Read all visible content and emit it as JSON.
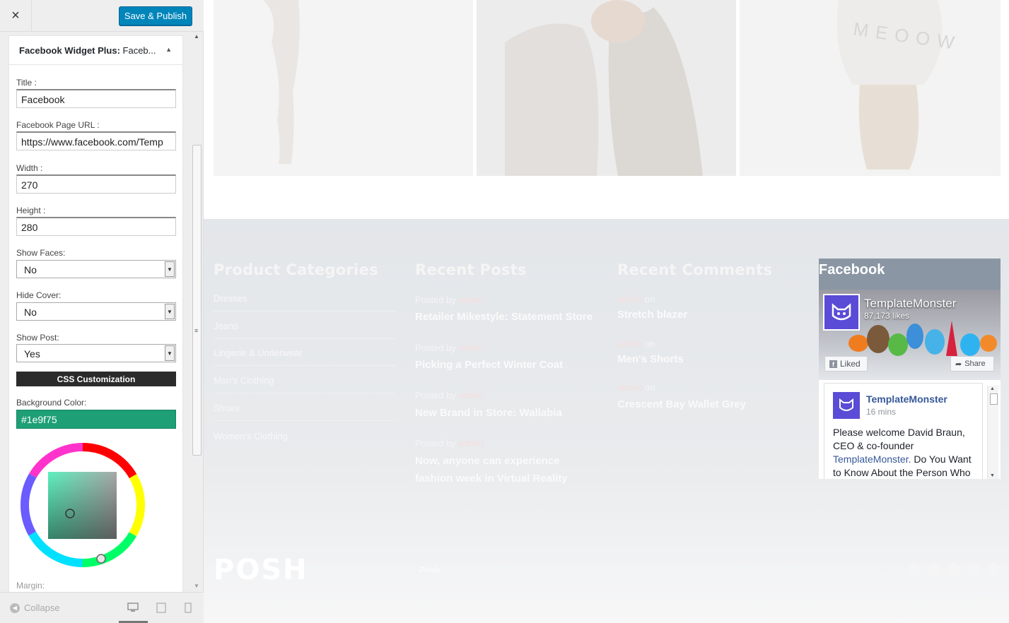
{
  "sidebar": {
    "close_icon": "×",
    "publish_label": "Save & Publish",
    "widget": {
      "title_main": "Facebook Widget Plus:",
      "title_sub": "Faceb...",
      "toggle_icon": "▲"
    },
    "fields": {
      "title_label": "Title :",
      "title_value": "Facebook",
      "url_label": "Facebook Page URL :",
      "url_value": "https://www.facebook.com/Temp",
      "width_label": "Width :",
      "width_value": "270",
      "height_label": "Height :",
      "height_value": "280",
      "show_faces_label": "Show Faces:",
      "show_faces_value": "No",
      "hide_cover_label": "Hide Cover:",
      "hide_cover_value": "No",
      "show_post_label": "Show Post:",
      "show_post_value": "Yes",
      "css_section": "CSS Customization",
      "bg_color_label": "Background Color:",
      "bg_color_value": "#1e9f75",
      "margin_label": "Margin:"
    },
    "collapse_label": "Collapse",
    "accent_color": "#0085ba"
  },
  "preview": {
    "footer": {
      "categories_title": "Product Categories",
      "categories": [
        "Dresses",
        "Jeans",
        "Lingerie & Underwear",
        "Men's Clothing",
        "Shoes",
        "Women's Clothing"
      ],
      "posts_title": "Recent Posts",
      "posts": [
        {
          "meta": "Posted by",
          "author": "admin",
          "title": "Retailer Mikestyle: Statement Store"
        },
        {
          "meta": "Posted by",
          "author": "admin",
          "title": "Picking a Perfect Winter Coat"
        },
        {
          "meta": "Posted by",
          "author": "admin",
          "title": "New Brand in Store: Wallabia"
        },
        {
          "meta": "Posted by",
          "author": "admin",
          "title": "Now, anyone can experience fashion week in Virtual Reality"
        }
      ],
      "comments_title": "Recent Comments",
      "comments": [
        {
          "author": "admin",
          "on": "on",
          "title": "Stretch blazer"
        },
        {
          "author": "admin",
          "on": "on",
          "title": "Men's Shorts"
        },
        {
          "author": "admin",
          "on": "on",
          "title": "Crescent Bay Wallet Grey"
        }
      ],
      "facebook": {
        "title": "Facebook",
        "page_name": "TemplateMonster",
        "likes": "87,173 likes",
        "liked_label": "Liked",
        "share_label": "Share",
        "post_name": "TemplateMonster",
        "post_time": "16 mins",
        "post_text_1": "Please welcome David Braun, CEO & co-founder",
        "post_link": "TemplateMonster.",
        "post_text_2": "Do You Want to Know About the Person Who"
      },
      "logo": "POSH",
      "copyright_brand": "Posh",
      "copyright_text": "is proudly powered by WordPress Entries (RSS) and Comments (RSS)."
    }
  }
}
